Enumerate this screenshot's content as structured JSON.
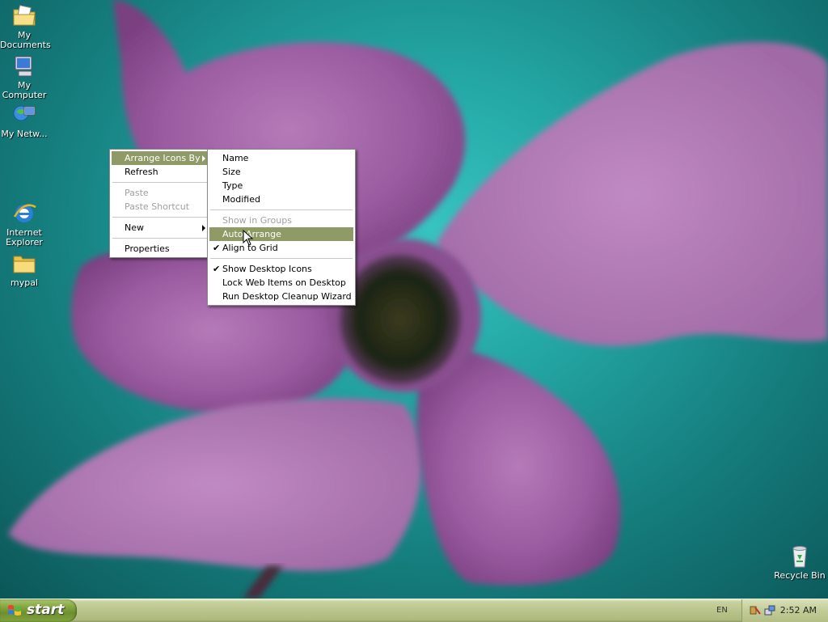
{
  "desktop": {
    "icons": [
      {
        "label": "My Documents",
        "icon": "folder-documents-icon"
      },
      {
        "label": "My Computer",
        "icon": "computer-icon"
      },
      {
        "label": "My Netw...",
        "icon": "network-icon"
      },
      {
        "label": "Internet Explorer",
        "icon": "internet-explorer-icon"
      },
      {
        "label": "mypal",
        "icon": "folder-icon"
      },
      {
        "label": "Recycle Bin",
        "icon": "recycle-bin-icon"
      }
    ]
  },
  "context_menu": {
    "items": [
      {
        "label": "Arrange Icons By",
        "highlighted": true,
        "submenu": true
      },
      {
        "label": "Refresh"
      },
      {
        "label": "Paste",
        "disabled": true
      },
      {
        "label": "Paste Shortcut",
        "disabled": true
      },
      {
        "label": "New",
        "submenu": true
      },
      {
        "label": "Properties"
      }
    ]
  },
  "submenu": {
    "items": [
      {
        "label": "Name"
      },
      {
        "label": "Size"
      },
      {
        "label": "Type"
      },
      {
        "label": "Modified"
      },
      {
        "label": "Show in Groups",
        "disabled": true
      },
      {
        "label": "Auto Arrange",
        "highlighted": true
      },
      {
        "label": "Align to Grid",
        "checked": true
      },
      {
        "label": "Show Desktop Icons",
        "checked": true
      },
      {
        "label": "Lock Web Items on Desktop"
      },
      {
        "label": "Run Desktop Cleanup Wizard"
      }
    ]
  },
  "taskbar": {
    "start_label": "start",
    "language": "EN",
    "clock": "2:52 AM"
  },
  "colors": {
    "highlight": "#8f9a66",
    "taskbar": "#b9c48c",
    "start_button": "#7ea13b"
  }
}
